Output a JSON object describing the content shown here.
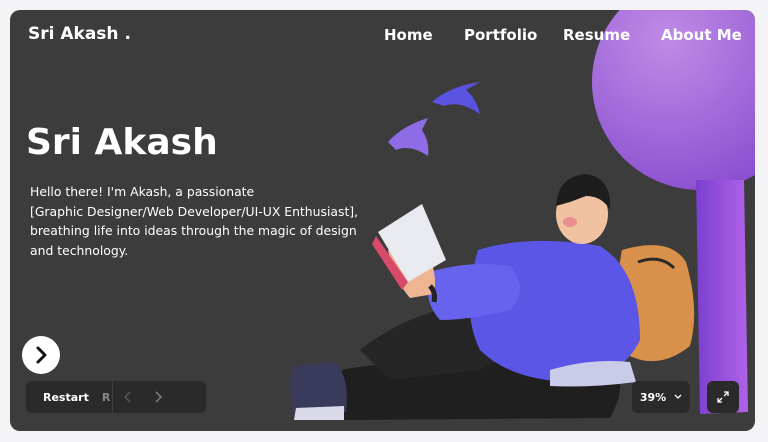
{
  "header": {
    "brand": "Sri Akash .",
    "nav": [
      "Home",
      "Portfolio",
      "Resume",
      "About Me"
    ]
  },
  "hero": {
    "title": "Sri Akash",
    "lines": [
      "Hello there! I'm Akash, a passionate",
      "[Graphic Designer/Web Developer/UI-UX Enthusiast],",
      "breathing life into ideas through the magic of design",
      "and technology."
    ]
  },
  "controls": {
    "restart_label": "Restart",
    "restart_key": "R",
    "zoom": "39%"
  },
  "icons": [
    "chevron-right-icon",
    "restart-icon",
    "prev-arrow-icon",
    "next-arrow-icon",
    "chevron-down-icon",
    "expand-icon"
  ],
  "colors": {
    "background": "#3c3c3c",
    "tree": "#9b63d8",
    "hoodie": "#5b56e6",
    "backpack": "#d9904a"
  }
}
